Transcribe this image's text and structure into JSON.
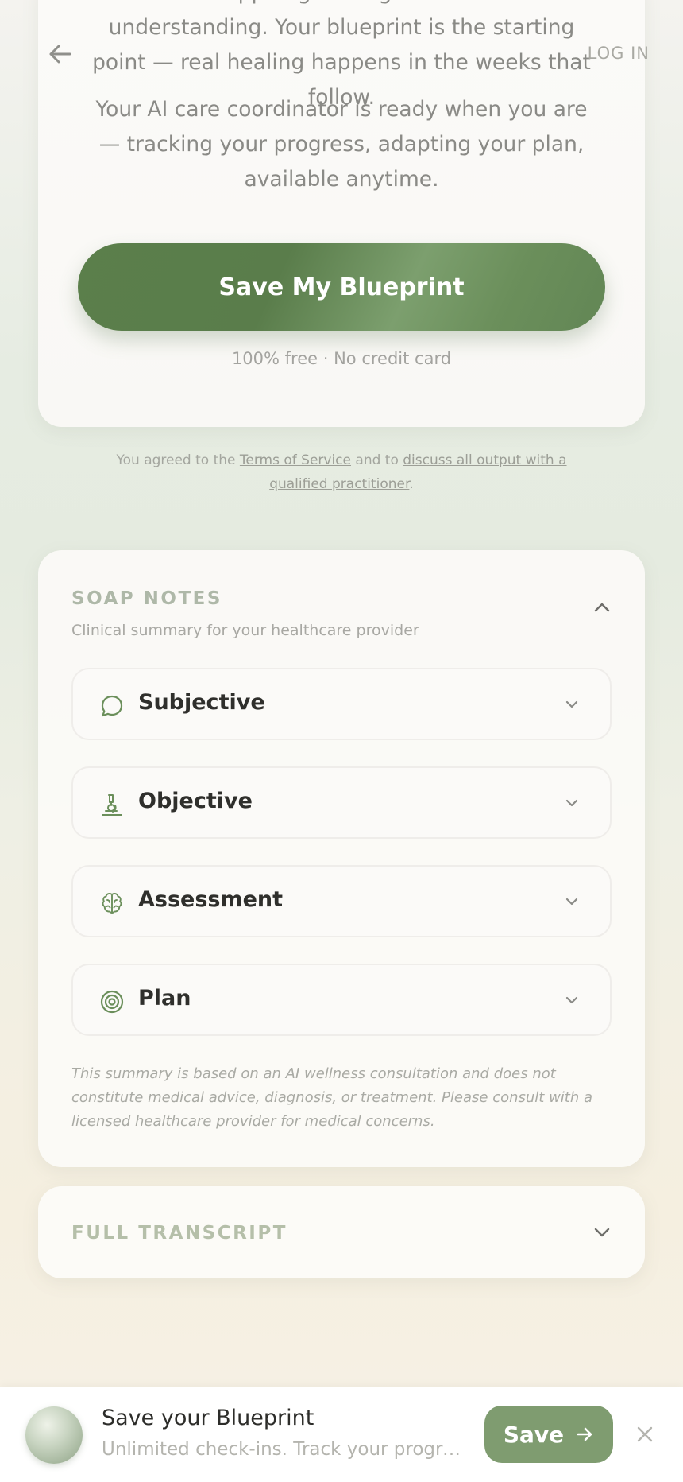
{
  "nav": {
    "back_icon": "arrow-left-icon",
    "login_label": "LOG IN"
  },
  "hero": {
    "paragraph1": "You stopped guessing and started understanding. Your blueprint is the starting point — real healing happens in the weeks that follow.",
    "paragraph2": "Your AI care coordinator is ready when you are — tracking your progress, adapting your plan, available anytime.",
    "cta_label": "Save My Blueprint",
    "cta_note": "100% free · No credit card"
  },
  "legal": {
    "prefix": "You agreed to the",
    "terms_link": "Terms of Service",
    "middle": "and to",
    "discuss_link": "discuss all output with a qualified practitioner",
    "suffix": "."
  },
  "soap": {
    "title": "SOAP NOTES",
    "subtitle": "Clinical summary for your healthcare provider",
    "items": [
      {
        "label": "Subjective",
        "icon": "chat-bubble-icon"
      },
      {
        "label": "Objective",
        "icon": "microscope-icon"
      },
      {
        "label": "Assessment",
        "icon": "brain-icon"
      },
      {
        "label": "Plan",
        "icon": "target-icon"
      }
    ],
    "disclaimer": "This summary is based on an AI wellness consultation and does not constitute medical advice, diagnosis, or treatment. Please consult with a licensed healthcare provider for medical concerns."
  },
  "transcript": {
    "title": "FULL TRANSCRIPT"
  },
  "banner": {
    "title": "Save your Blueprint",
    "subtitle": "Unlimited check-ins. Track your progress. Adapt your plan.",
    "save_label": "Save",
    "close_icon": "close-icon"
  },
  "colors": {
    "accent_green": "#6b8f5b",
    "banner_button": "#7f9c70",
    "section_title": "#aeb8a8"
  }
}
